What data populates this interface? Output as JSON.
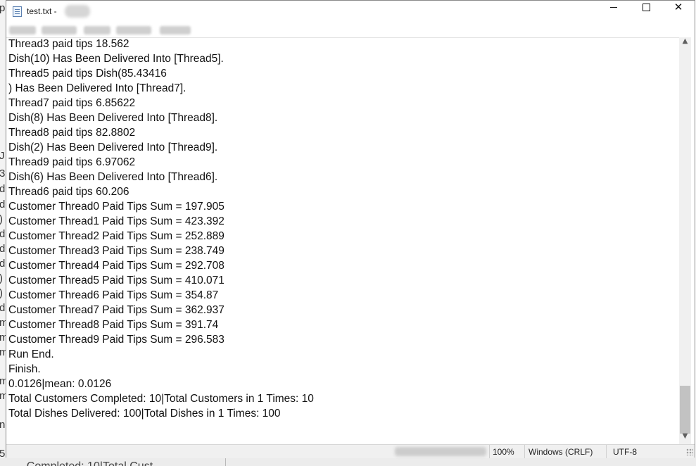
{
  "titlebar": {
    "title": "test.txt -",
    "minimize_icon": "minimize-icon",
    "maximize_icon": "maximize-icon",
    "close_icon": "close-icon",
    "close_symbol": "✕"
  },
  "editor": {
    "lines": [
      "Thread3 paid tips 18.562",
      "Dish(10) Has Been Delivered Into [Thread5].",
      "Thread5 paid tips Dish(85.43416",
      ") Has Been Delivered Into [Thread7].",
      "Thread7 paid tips 6.85622",
      "Dish(8) Has Been Delivered Into [Thread8].",
      "Thread8 paid tips 82.8802",
      "Dish(2) Has Been Delivered Into [Thread9].",
      "Thread9 paid tips 6.97062",
      "Dish(6) Has Been Delivered Into [Thread6].",
      "Thread6 paid tips 60.206",
      "Customer Thread0 Paid Tips Sum = 197.905",
      "Customer Thread1 Paid Tips Sum = 423.392",
      "Customer Thread2 Paid Tips Sum = 252.889",
      "Customer Thread3 Paid Tips Sum = 238.749",
      "Customer Thread4 Paid Tips Sum = 292.708",
      "Customer Thread5 Paid Tips Sum = 410.071",
      "Customer Thread6 Paid Tips Sum = 354.87",
      "Customer Thread7 Paid Tips Sum = 362.937",
      "Customer Thread8 Paid Tips Sum = 391.74",
      "Customer Thread9 Paid Tips Sum = 296.583",
      "Run End.",
      "Finish.",
      "0.0126|mean: 0.0126",
      "Total Customers Completed: 10|Total Customers in 1 Times: 10",
      "Total Dishes Delivered: 100|Total Dishes in 1 Times: 100"
    ]
  },
  "scrollbar": {
    "up_arrow": "▲",
    "down_arrow": "▼"
  },
  "statusbar": {
    "zoom": "100%",
    "line_ending": "Windows (CRLF)",
    "encoding": "UTF-8"
  },
  "background": {
    "left_fragments": [
      "p",
      "J",
      "3",
      "d",
      "d",
      ")",
      "d",
      "d",
      "d",
      ")",
      ")",
      "d",
      "m",
      "m",
      "m",
      "m",
      "m",
      "n",
      "5"
    ],
    "bottom_text": "... Completed: 10|Total Cust..."
  }
}
